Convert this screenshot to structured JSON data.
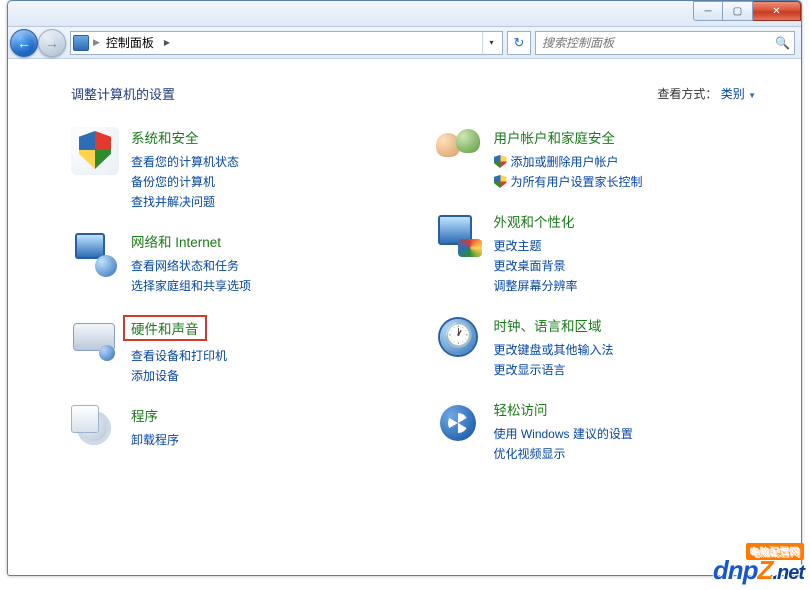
{
  "window": {
    "minimize": "─",
    "maximize": "▢",
    "close": "✕"
  },
  "nav": {
    "back": "←",
    "forward": "→",
    "breadcrumb_root": "控制面板",
    "refresh_glyph": "↻",
    "search_placeholder": "搜索控制面板",
    "search_icon": "🔍"
  },
  "heading": "调整计算机的设置",
  "viewby": {
    "label": "查看方式：",
    "value": "类别"
  },
  "left_categories": [
    {
      "icon": "ic-shield",
      "title": "系统和安全",
      "highlight": false,
      "subs": [
        "查看您的计算机状态",
        "备份您的计算机",
        "查找并解决问题"
      ],
      "shields": []
    },
    {
      "icon": "ic-net",
      "title": "网络和 Internet",
      "highlight": false,
      "subs": [
        "查看网络状态和任务",
        "选择家庭组和共享选项"
      ],
      "shields": []
    },
    {
      "icon": "ic-hw",
      "title": "硬件和声音",
      "highlight": true,
      "subs": [
        "查看设备和打印机",
        "添加设备"
      ],
      "shields": []
    },
    {
      "icon": "ic-prog",
      "title": "程序",
      "highlight": false,
      "subs": [
        "卸载程序"
      ],
      "shields": []
    }
  ],
  "right_categories": [
    {
      "icon": "ic-user",
      "title": "用户帐户和家庭安全",
      "highlight": false,
      "subs": [
        "添加或删除用户帐户",
        "为所有用户设置家长控制"
      ],
      "shields": [
        0,
        1
      ]
    },
    {
      "icon": "ic-appear",
      "title": "外观和个性化",
      "highlight": false,
      "subs": [
        "更改主题",
        "更改桌面背景",
        "调整屏幕分辨率"
      ],
      "shields": []
    },
    {
      "icon": "ic-clock",
      "title": "时钟、语言和区域",
      "highlight": false,
      "subs": [
        "更改键盘或其他输入法",
        "更改显示语言"
      ],
      "shields": []
    },
    {
      "icon": "ic-ease",
      "title": "轻松访问",
      "highlight": false,
      "subs": [
        "使用 Windows 建议的设置",
        "优化视频显示"
      ],
      "shields": []
    }
  ],
  "watermark": {
    "main": "dnp",
    "z": "Z",
    "net": ".net",
    "badge": "电脑配置网"
  }
}
